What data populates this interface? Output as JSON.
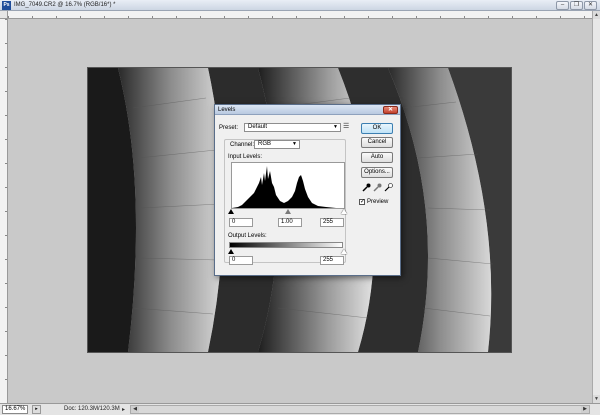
{
  "window": {
    "title": "IMG_7049.CR2 @ 16.7% (RGB/16*) *",
    "app_icon": "Ps",
    "controls": [
      "minimize-icon",
      "restore-icon",
      "close-icon"
    ]
  },
  "status_bar": {
    "zoom": "16.67%",
    "doc_info": "Doc: 120.3M/120.3M"
  },
  "dialog": {
    "title": "Levels",
    "preset_label": "Preset:",
    "preset_value": "Default",
    "channel_label": "Channel:",
    "channel_value": "RGB",
    "input_levels_label": "Input Levels:",
    "input_black": "0",
    "input_gamma": "1.00",
    "input_white": "255",
    "output_levels_label": "Output Levels:",
    "output_black": "0",
    "output_white": "255",
    "buttons": {
      "ok": "OK",
      "cancel": "Cancel",
      "auto": "Auto",
      "options": "Options..."
    },
    "preview_label": "Preview",
    "preview_checked": true,
    "eyedroppers": [
      "black-point-eyedropper-icon",
      "gray-point-eyedropper-icon",
      "white-point-eyedropper-icon"
    ]
  },
  "colors": {
    "workspace": "#c9c9c9",
    "ok_accent": "#3c7fb1",
    "close_red": "#c4412c"
  }
}
